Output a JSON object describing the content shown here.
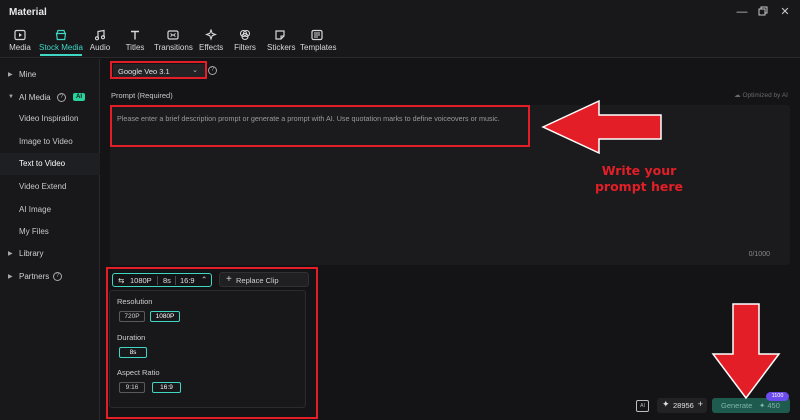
{
  "window": {
    "title": "Material"
  },
  "toolbar": {
    "items": [
      {
        "label": "Media",
        "icon": "media-icon"
      },
      {
        "label": "Stock Media",
        "icon": "stock-media-icon",
        "active": true
      },
      {
        "label": "Audio",
        "icon": "music-note-icon"
      },
      {
        "label": "Titles",
        "icon": "text-icon"
      },
      {
        "label": "Transitions",
        "icon": "transitions-icon"
      },
      {
        "label": "Effects",
        "icon": "sparkle-icon"
      },
      {
        "label": "Filters",
        "icon": "filters-icon"
      },
      {
        "label": "Stickers",
        "icon": "sticker-icon"
      },
      {
        "label": "Templates",
        "icon": "templates-icon"
      }
    ]
  },
  "sidebar": {
    "mine": "Mine",
    "ai_media": "AI Media",
    "ai_badge": "AI",
    "items": [
      "Video Inspiration",
      "Image to Video",
      "Text to Video",
      "Video Extend",
      "AI Image",
      "My Files"
    ],
    "active_item": "Text to Video",
    "library": "Library",
    "partners": "Partners"
  },
  "main": {
    "model": "Google Veo 3.1",
    "prompt_label": "Prompt (Required)",
    "optimized": "Optimized by AI",
    "prompt_placeholder": "Please enter a brief description prompt or generate a prompt with AI. Use quotation marks to define voiceovers or music.",
    "counter": "0/1000",
    "settings": {
      "resolution": "1080P",
      "duration": "8s",
      "ratio": "16:9"
    },
    "replace_clip": "Replace Clip",
    "panel": {
      "resolution_label": "Resolution",
      "resolution_options": [
        "720P",
        "1080P"
      ],
      "duration_label": "Duration",
      "duration_options": [
        "8s"
      ],
      "aspect_label": "Aspect Ratio",
      "aspect_options": [
        "9:16",
        "16:9"
      ]
    },
    "credits": "28956",
    "generate": "Generate",
    "generate_cost": "450",
    "promo_badge": "1100"
  },
  "annotation": {
    "text_line1": "Write your",
    "text_line2": "prompt here",
    "color": "#e41e26"
  },
  "colors": {
    "accent": "#3fd6c4",
    "annotation_red": "#e41e26",
    "ai_badge": "#2bd19a"
  }
}
